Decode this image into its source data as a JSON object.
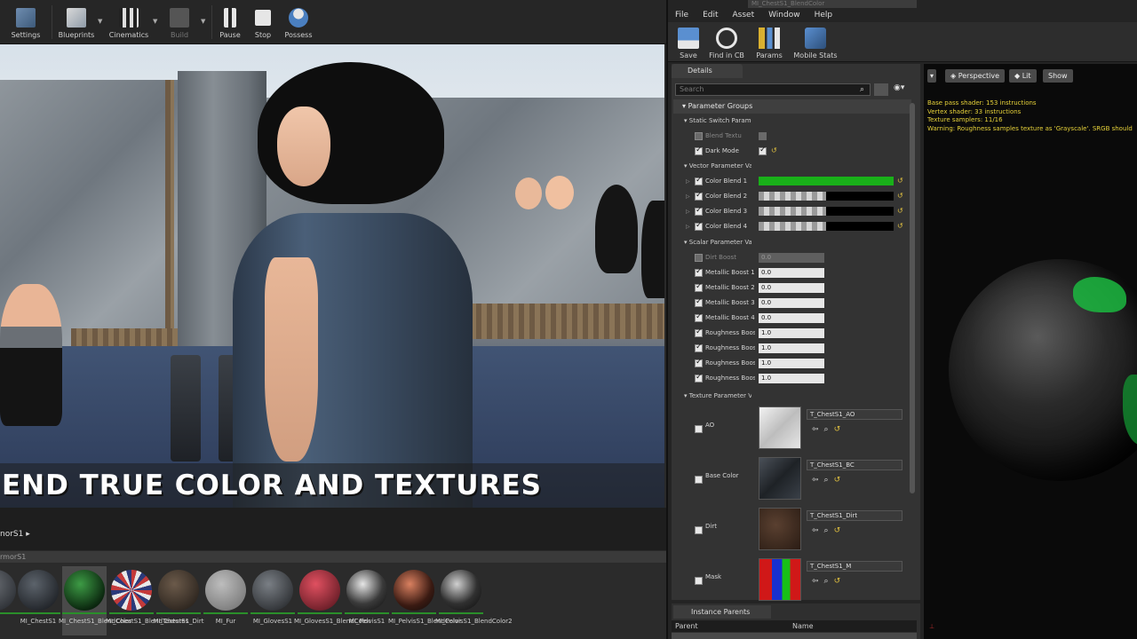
{
  "left_toolbar": {
    "buttons": [
      "Settings",
      "Blueprints",
      "Cinematics",
      "Build",
      "Pause",
      "Stop",
      "Possess"
    ]
  },
  "viewport": {
    "caption": "END TRUE COLOR AND TEXTURES"
  },
  "content_browser": {
    "path": "norS1",
    "sub_path": "rmorS1",
    "thumbnails": [
      {
        "label": ""
      },
      {
        "label": "MI_ChestS1"
      },
      {
        "label": "MI_ChestS1_BlendColor"
      },
      {
        "label": "MI_ChestS1_BlendTextures"
      },
      {
        "label": "MI_ChestS1_Dirt"
      },
      {
        "label": "MI_Fur"
      },
      {
        "label": "MI_GlovesS1"
      },
      {
        "label": "MI_GlovesS1_BlendColor"
      },
      {
        "label": "MI_PelvisS1"
      },
      {
        "label": "MI_PelvisS1_BlendColor"
      },
      {
        "label": "MI_PelvisS1_BlendColor2"
      }
    ]
  },
  "material_editor": {
    "title": "MI_ChestS1_BlendColor",
    "menu": [
      "File",
      "Edit",
      "Asset",
      "Window",
      "Help"
    ],
    "toolbar": [
      "Save",
      "Find in CB",
      "Params",
      "Mobile Stats"
    ],
    "details_tab": "Details",
    "search_placeholder": "Search",
    "parameter_groups_label": "Parameter Groups",
    "groups": {
      "static_switch": "Static Switch Parame",
      "vector": "Vector Parameter Va",
      "scalar": "Scalar Parameter Va",
      "texture": "Texture Parameter V"
    },
    "static_switch_rows": [
      {
        "name": "Blend Textu",
        "enabled": false
      },
      {
        "name": "Dark Mode",
        "enabled": true
      }
    ],
    "vector_rows": [
      {
        "name": "Color Blend 1",
        "color": "#19b019",
        "fill": 1.0
      },
      {
        "name": "Color Blend 2",
        "color": "checker",
        "fill": 0.5
      },
      {
        "name": "Color Blend 3",
        "color": "checker",
        "fill": 0.5
      },
      {
        "name": "Color Blend 4",
        "color": "checker",
        "fill": 0.5
      }
    ],
    "scalar_rows": [
      {
        "name": "Dirt Boost",
        "value": "0.0",
        "enabled": false
      },
      {
        "name": "Metallic Boost 1",
        "value": "0.0",
        "enabled": true
      },
      {
        "name": "Metallic Boost 2",
        "value": "0.0",
        "enabled": true
      },
      {
        "name": "Metallic Boost 3",
        "value": "0.0",
        "enabled": true
      },
      {
        "name": "Metallic Boost 4",
        "value": "0.0",
        "enabled": true
      },
      {
        "name": "Roughness Boos",
        "value": "1.0",
        "enabled": true
      },
      {
        "name": "Roughness Boos",
        "value": "1.0",
        "enabled": true
      },
      {
        "name": "Roughness Boos",
        "value": "1.0",
        "enabled": true
      },
      {
        "name": "Roughness Boos",
        "value": "1.0",
        "enabled": true
      }
    ],
    "texture_rows": [
      {
        "name": "AO",
        "texture": "T_ChestS1_AO",
        "tone": "#dcdcdc"
      },
      {
        "name": "Base Color",
        "texture": "T_ChestS1_BC",
        "tone": "#2d3238"
      },
      {
        "name": "Dirt",
        "texture": "T_ChestS1_Dirt",
        "tone": "#3c2a1f"
      },
      {
        "name": "Mask",
        "texture": "T_ChestS1_M",
        "tone": "#c01818"
      }
    ],
    "instance_parents": {
      "tab": "Instance Parents",
      "col_parent": "Parent",
      "col_name": "Name"
    }
  },
  "preview": {
    "perspective": "Perspective",
    "lit": "Lit",
    "show": "Show",
    "stats": [
      "Base pass shader: 153 instructions",
      "Vertex shader: 33 instructions",
      "Texture samplers: 11/16",
      "Warning: Roughness samples texture as 'Grayscale'. SRGB should"
    ]
  }
}
